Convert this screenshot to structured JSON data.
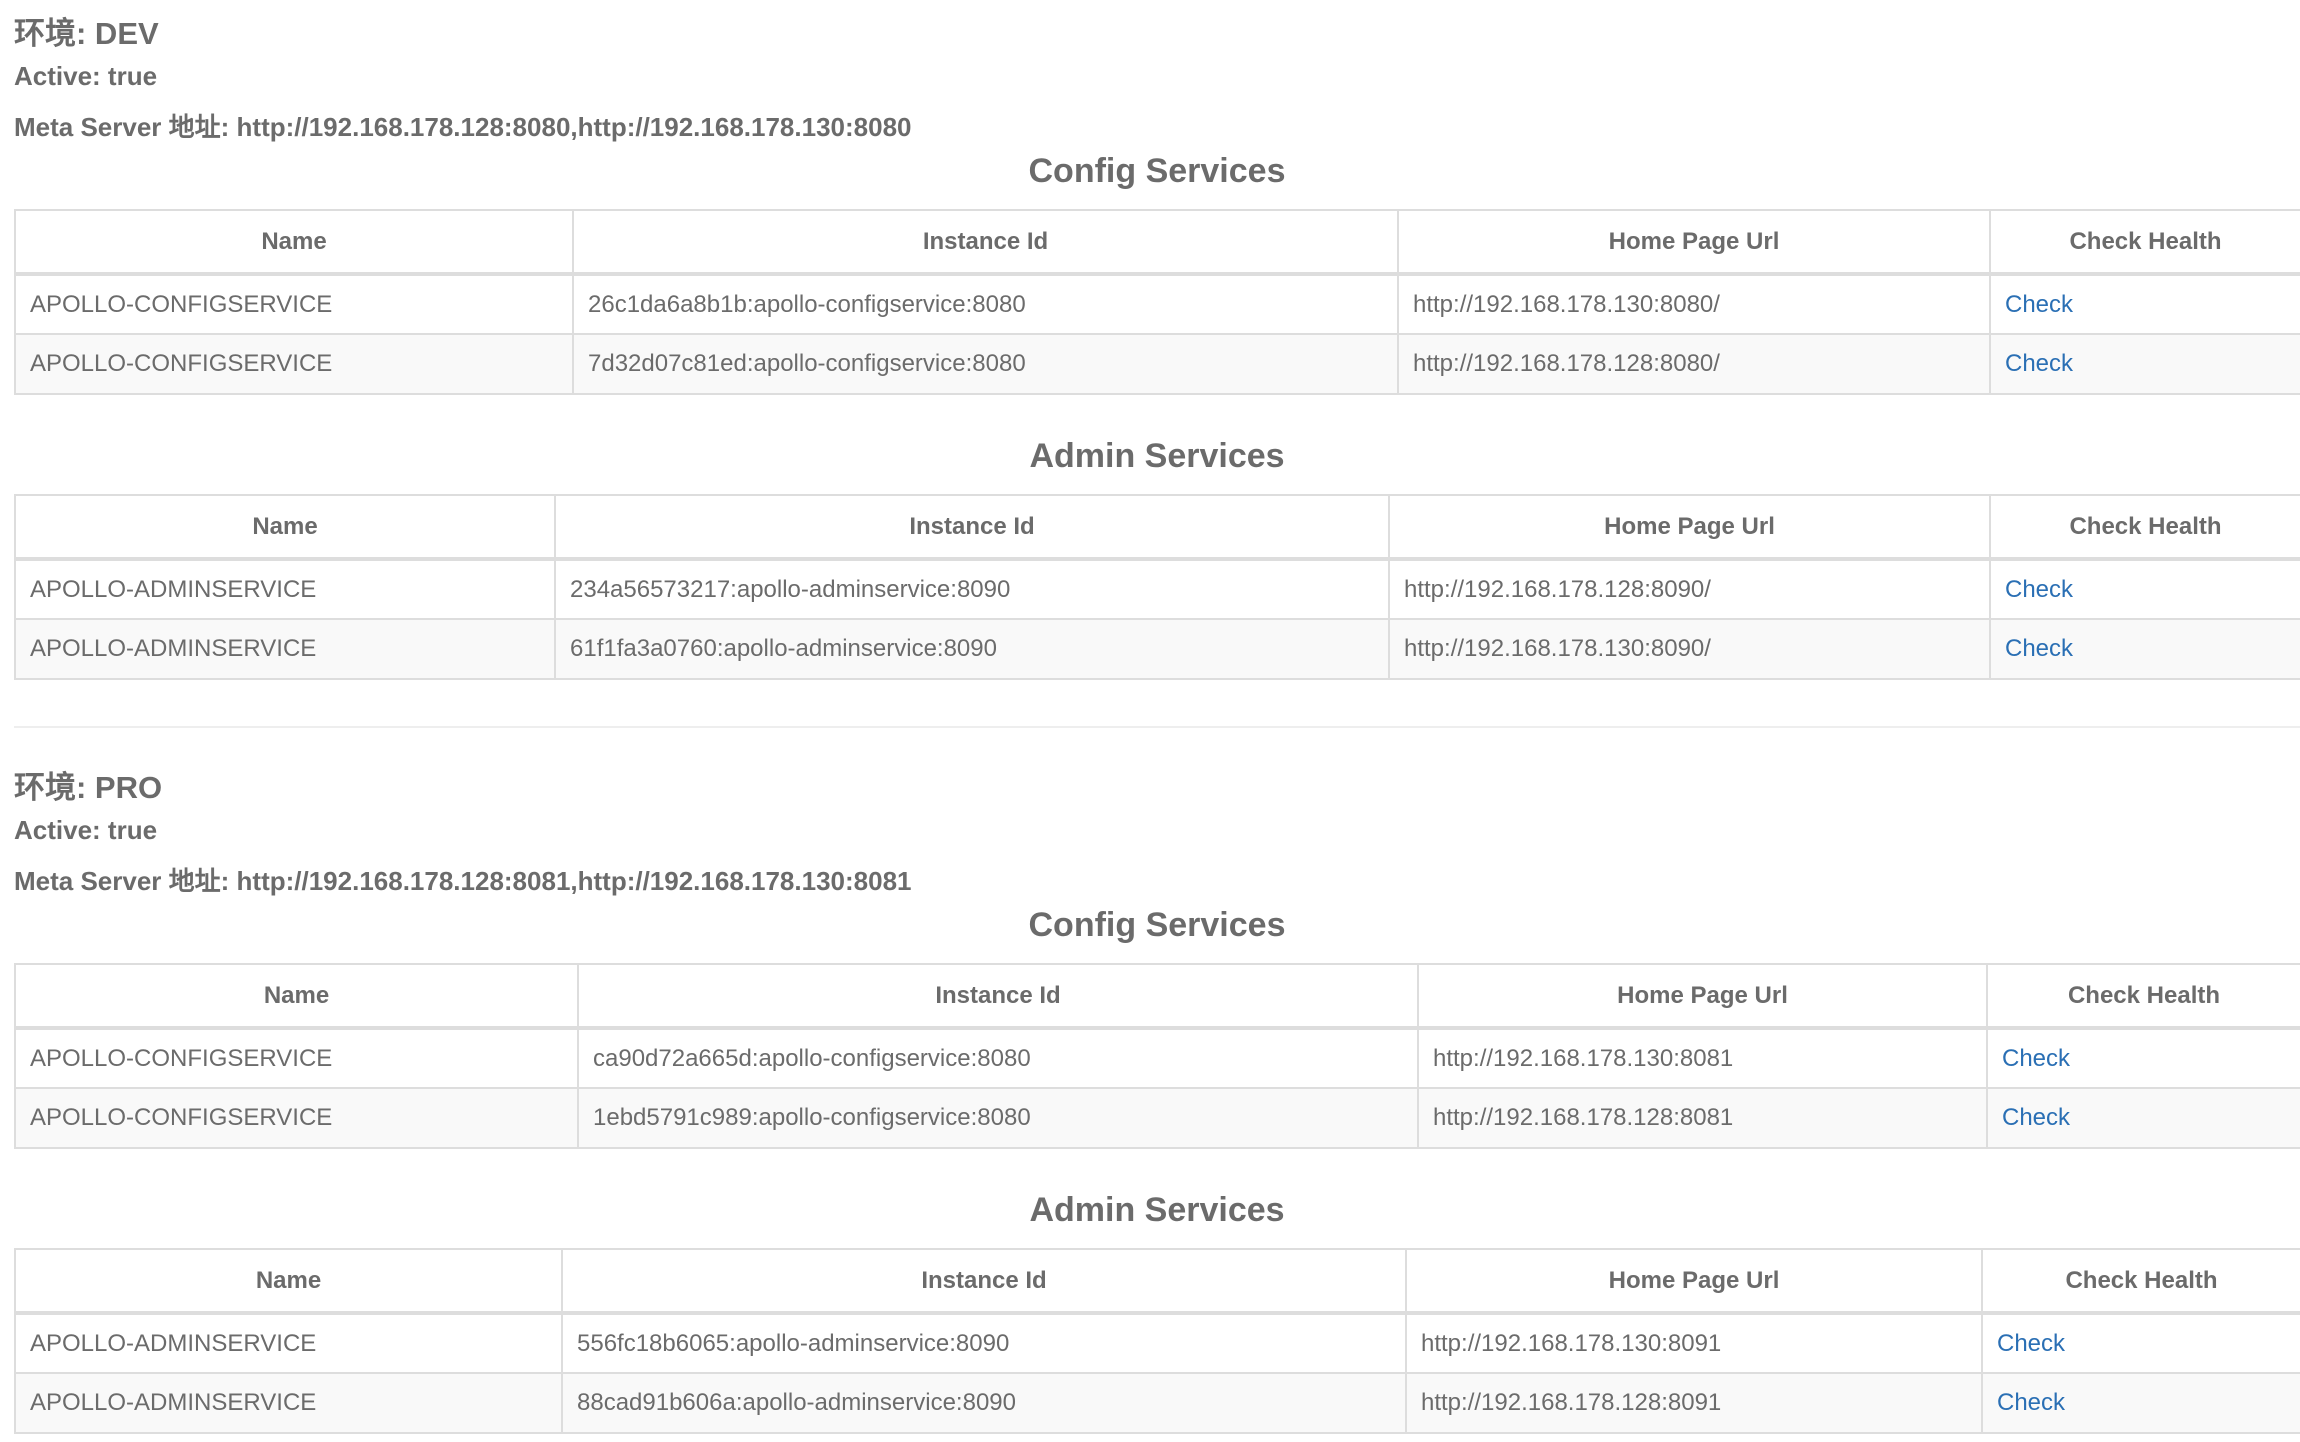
{
  "environments": [
    {
      "title": "环境: DEV",
      "active": "Active: true",
      "meta": "Meta Server 地址: http://192.168.178.128:8080,http://192.168.178.130:8080",
      "config": {
        "title": "Config Services",
        "headers": [
          "Name",
          "Instance Id",
          "Home Page Url",
          "Check Health"
        ],
        "rows": [
          [
            "APOLLO-CONFIGSERVICE",
            "26c1da6a8b1b:apollo-configservice:8080",
            "http://192.168.178.130:8080/",
            "Check"
          ],
          [
            "APOLLO-CONFIGSERVICE",
            "7d32d07c81ed:apollo-configservice:8080",
            "http://192.168.178.128:8080/",
            "Check"
          ]
        ]
      },
      "admin": {
        "title": "Admin Services",
        "headers": [
          "Name",
          "Instance Id",
          "Home Page Url",
          "Check Health"
        ],
        "rows": [
          [
            "APOLLO-ADMINSERVICE",
            "234a56573217:apollo-adminservice:8090",
            "http://192.168.178.128:8090/",
            "Check"
          ],
          [
            "APOLLO-ADMINSERVICE",
            "61f1fa3a0760:apollo-adminservice:8090",
            "http://192.168.178.130:8090/",
            "Check"
          ]
        ]
      }
    },
    {
      "title": "环境: PRO",
      "active": "Active: true",
      "meta": "Meta Server 地址: http://192.168.178.128:8081,http://192.168.178.130:8081",
      "config": {
        "title": "Config Services",
        "headers": [
          "Name",
          "Instance Id",
          "Home Page Url",
          "Check Health"
        ],
        "rows": [
          [
            "APOLLO-CONFIGSERVICE",
            "ca90d72a665d:apollo-configservice:8080",
            "http://192.168.178.130:8081",
            "Check"
          ],
          [
            "APOLLO-CONFIGSERVICE",
            "1ebd5791c989:apollo-configservice:8080",
            "http://192.168.178.128:8081",
            "Check"
          ]
        ]
      },
      "admin": {
        "title": "Admin Services",
        "headers": [
          "Name",
          "Instance Id",
          "Home Page Url",
          "Check Health"
        ],
        "rows": [
          [
            "APOLLO-ADMINSERVICE",
            "556fc18b6065:apollo-adminservice:8090",
            "http://192.168.178.130:8091",
            "Check"
          ],
          [
            "APOLLO-ADMINSERVICE",
            "88cad91b606a:apollo-adminservice:8090",
            "http://192.168.178.128:8091",
            "Check"
          ]
        ]
      }
    }
  ]
}
